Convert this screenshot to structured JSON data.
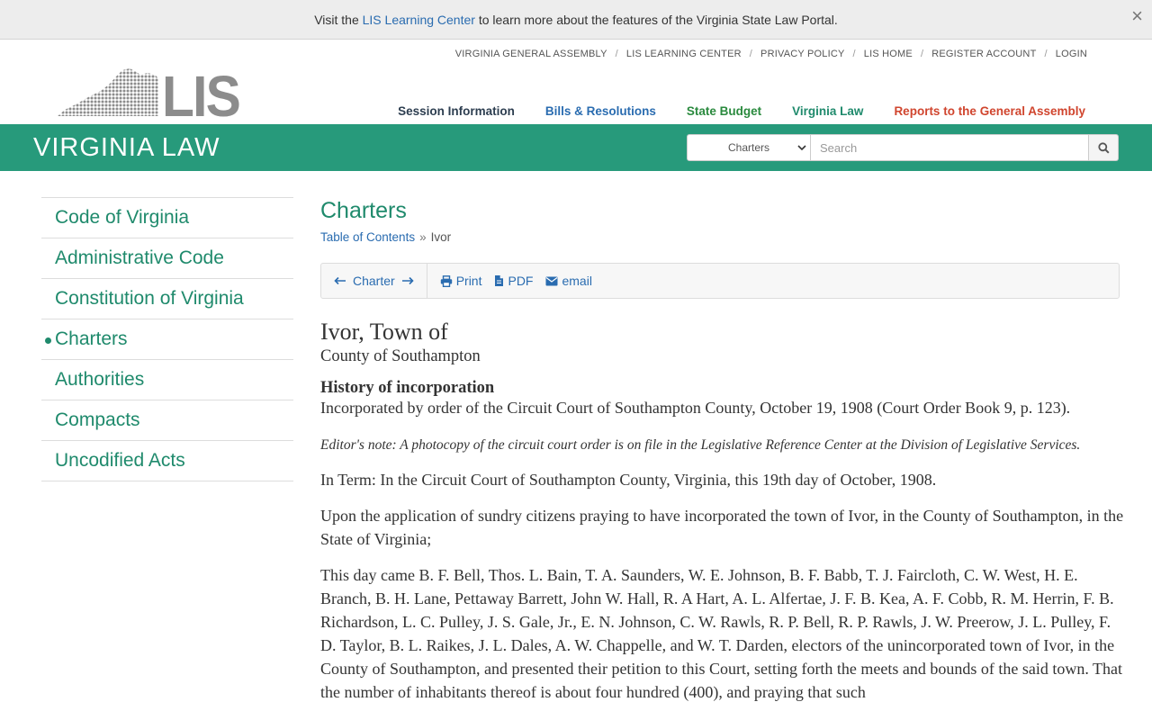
{
  "notice": {
    "before": "Visit the ",
    "link": "LIS Learning Center",
    "after": " to learn more about the features of the Virginia State Law Portal.",
    "close": "×"
  },
  "toplinks": [
    "VIRGINIA GENERAL ASSEMBLY",
    "LIS LEARNING CENTER",
    "PRIVACY POLICY",
    "LIS HOME",
    "REGISTER ACCOUNT",
    "LOGIN"
  ],
  "logo": {
    "text": "LIS"
  },
  "mainnav": [
    {
      "label": "Session Information",
      "color": "#2d3e50"
    },
    {
      "label": "Bills & Resolutions",
      "color": "#2a6cb0"
    },
    {
      "label": "State Budget",
      "color": "#2a8a3e"
    },
    {
      "label": "Virginia Law",
      "color": "#1f8a6c"
    },
    {
      "label": "Reports to the General Assembly",
      "color": "#d0452e"
    }
  ],
  "band": {
    "title": "VIRGINIA LAW",
    "select_value": "Charters",
    "search_placeholder": "Search"
  },
  "sidebar": [
    {
      "label": "Code of Virginia",
      "active": false
    },
    {
      "label": "Administrative Code",
      "active": false
    },
    {
      "label": "Constitution of Virginia",
      "active": false
    },
    {
      "label": "Charters",
      "active": true
    },
    {
      "label": "Authorities",
      "active": false
    },
    {
      "label": "Compacts",
      "active": false
    },
    {
      "label": "Uncodified Acts",
      "active": false
    }
  ],
  "content": {
    "heading": "Charters",
    "breadcrumb": {
      "link": "Table of Contents",
      "sep": "»",
      "current": "Ivor"
    },
    "toolbar": {
      "nav_label": "Charter",
      "print": "Print",
      "pdf": "PDF",
      "email": "email"
    },
    "doc": {
      "title": "Ivor, Town of",
      "county": "County of Southampton",
      "history_heading": "History of incorporation",
      "history_text": "Incorporated by order of the Circuit Court of Southampton County, October 19, 1908 (Court Order Book 9, p. 123).",
      "editor_note": "Editor's note: A photocopy of the circuit court order is on file in the Legislative Reference Center at the Division of Legislative Services.",
      "para1": "In Term: In the Circuit Court of Southampton County, Virginia, this 19th day of October, 1908.",
      "para2": "Upon the application of sundry citizens praying to have incorporated the town of Ivor, in the County of Southampton, in the State of Virginia;",
      "para3": "This day came B. F. Bell, Thos. L. Bain, T. A. Saunders, W. E. Johnson, B. F. Babb, T. J. Faircloth, C. W. West, H. E. Branch, B. H. Lane, Pettaway Barrett, John W. Hall, R. A Hart, A. L. Alfertae, J. F. B. Kea, A. F. Cobb, R. M. Herrin, F. B. Richardson, L. C. Pulley, J. S. Gale, Jr., E. N. Johnson, C. W. Rawls, R. P. Bell, R. P. Rawls, J. W. Preerow, J. L. Pulley, F. D. Taylor, B. L. Raikes, J. L. Dales, A. W. Chappelle, and W. T. Darden, electors of the unincorporated town of Ivor, in the County of Southampton, and presented their petition to this Court, setting forth the meets and bounds of the said town. That the number of inhabitants thereof is about four hundred (400), and praying that such"
    }
  },
  "colors": {
    "accent": "#279a7b",
    "link": "#2a6cb0",
    "sidebar_text": "#1f8a6c",
    "logo_gray": "#8c8c8c"
  }
}
